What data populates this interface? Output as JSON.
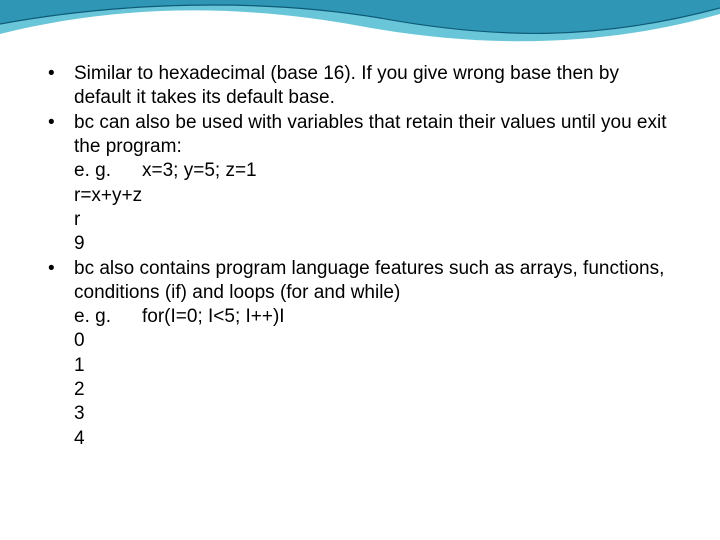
{
  "bullets": [
    {
      "text": "Similar to hexadecimal (base 16). If you give wrong base then by default it takes its default base."
    },
    {
      "text": "bc can also be used with variables that retain their values until you exit the program:",
      "eg_label": "e. g.",
      "eg_line": "x=3; y=5; z=1",
      "lines": [
        "r=x+y+z",
        "r",
        "9"
      ]
    },
    {
      "text": "bc also contains program language features such as arrays, functions, conditions (if) and loops (for and while)",
      "eg_label": "e. g.",
      "eg_line": "for(I=0; I<5; I++)I",
      "lines": [
        "0",
        "1",
        "2",
        "3",
        "4"
      ]
    }
  ],
  "colors": {
    "wave_light": "#69c5d8",
    "wave_dark": "#2f97b5",
    "wave_line": "#0d5b78"
  }
}
